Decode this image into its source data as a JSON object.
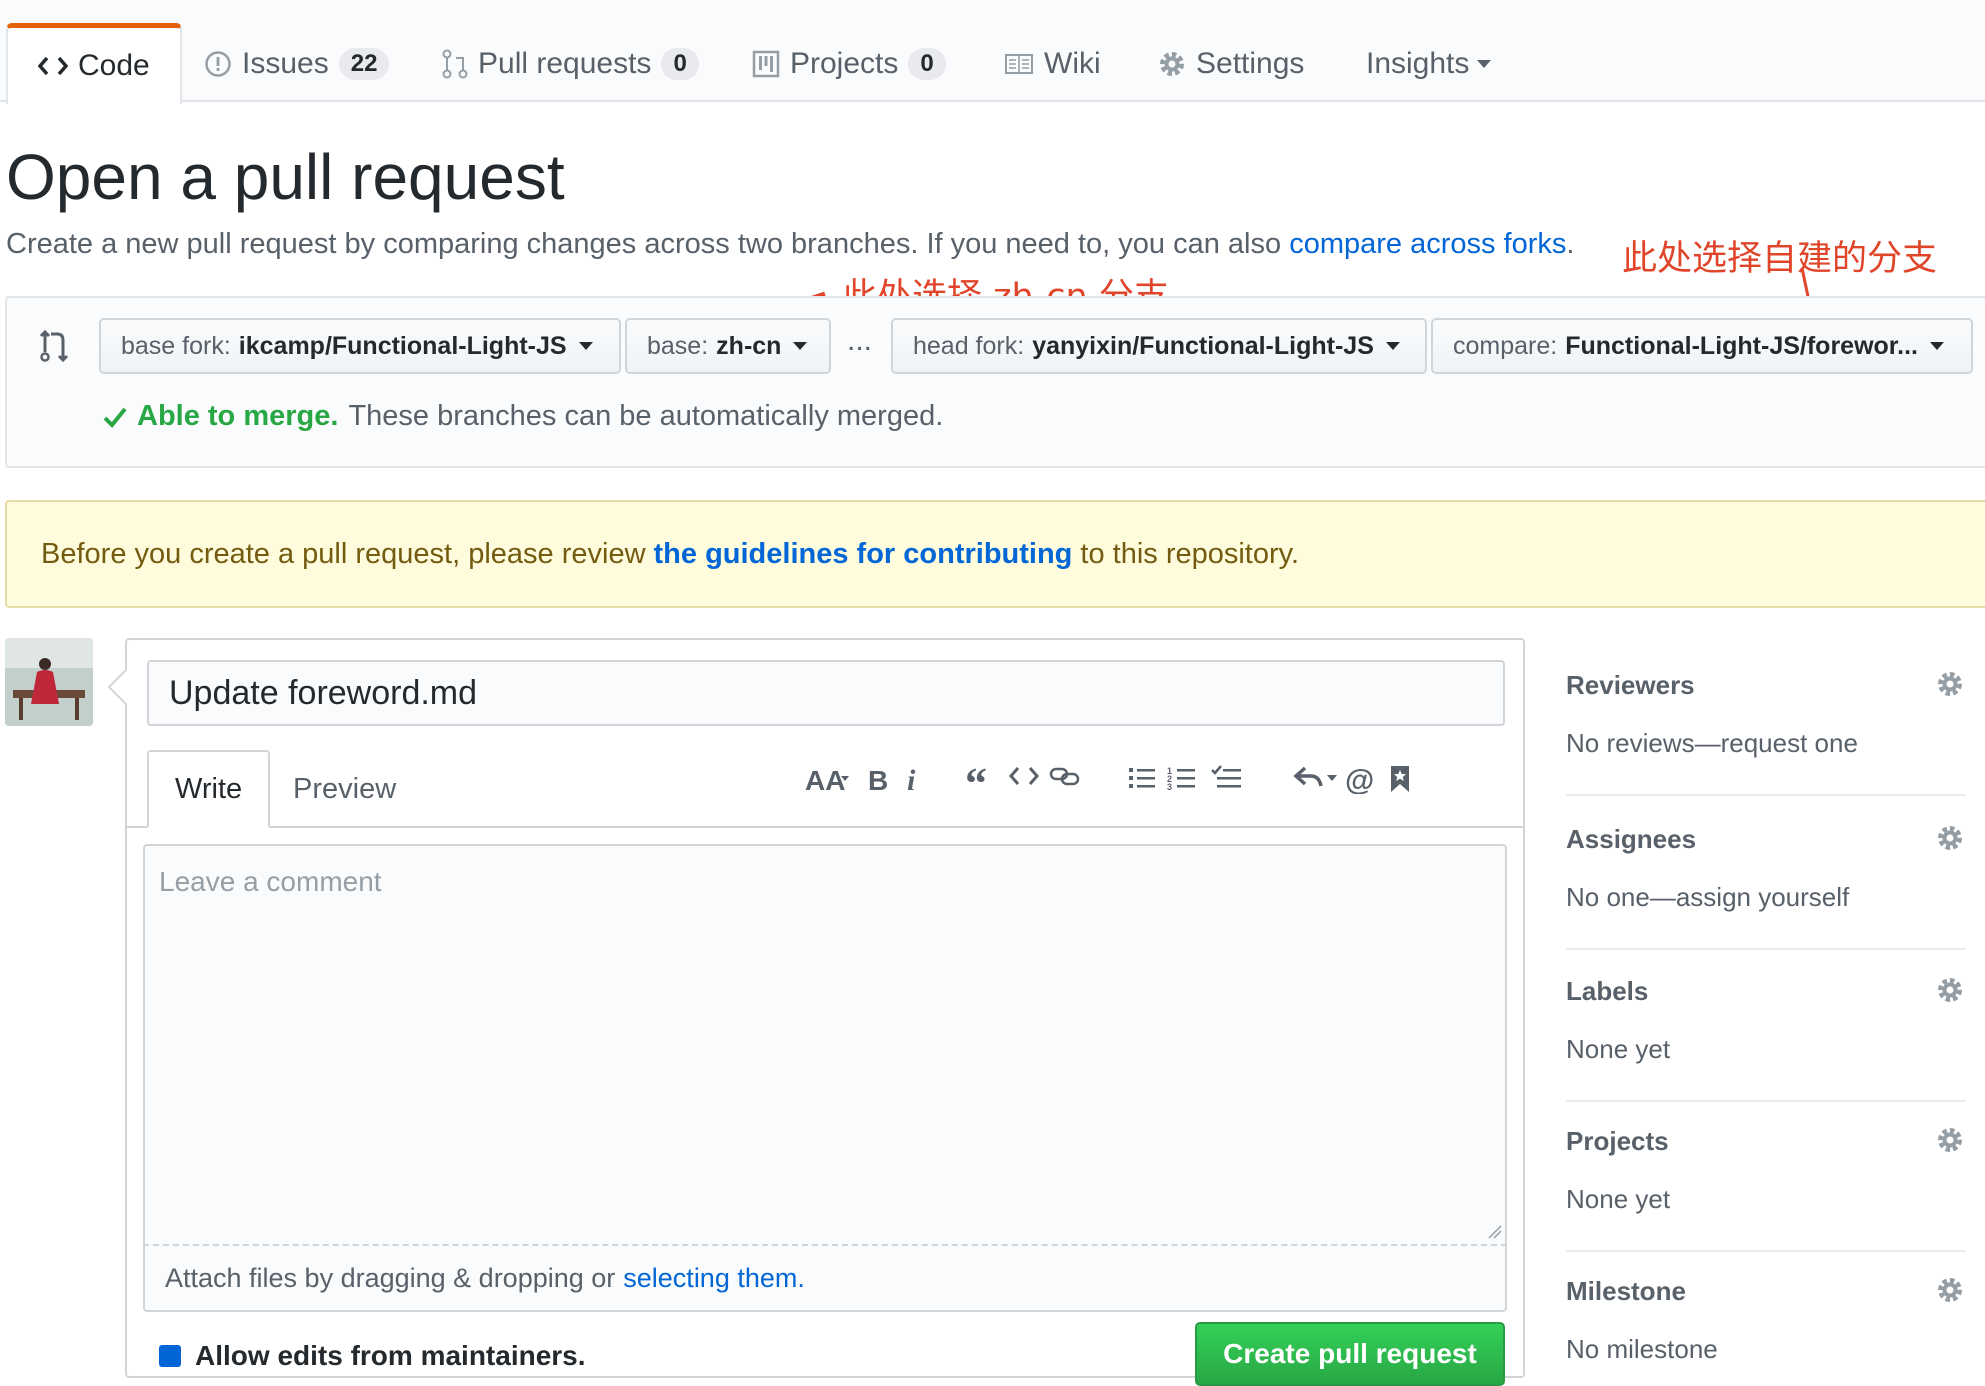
{
  "nav": {
    "tabs": [
      {
        "label": "Code"
      },
      {
        "label": "Issues",
        "count": "22"
      },
      {
        "label": "Pull requests",
        "count": "0"
      },
      {
        "label": "Projects",
        "count": "0"
      },
      {
        "label": "Wiki"
      },
      {
        "label": "Settings"
      },
      {
        "label": "Insights"
      }
    ]
  },
  "header": {
    "title": "Open a pull request",
    "subtitle": "Create a new pull request by comparing changes across two branches. If you need to, you can also",
    "subtitle_link": "compare across forks",
    "subtitle_end": "."
  },
  "annotations": {
    "base_note": "此处选择 zh-cn 分支",
    "compare_note": "此处选择自建的分支",
    "color": "#e0452a"
  },
  "compare": {
    "base_fork_label": "base fork:",
    "base_fork_value": "ikcamp/Functional-Light-JS",
    "base_label": "base:",
    "base_value": "zh-cn",
    "separator": "...",
    "head_fork_label": "head fork:",
    "head_fork_value": "yanyixin/Functional-Light-JS",
    "compare_label": "compare:",
    "compare_value": "Functional-Light-JS/forewor...",
    "merge_status": "Able to merge.",
    "merge_message": "These branches can be automatically merged."
  },
  "flash": {
    "before": "Before you create a pull request, please review",
    "link": "the guidelines for contributing",
    "after": "to this repository."
  },
  "composer": {
    "title_value": "Update foreword.md",
    "tab_write": "Write",
    "tab_preview": "Preview",
    "comment_placeholder": "Leave a comment",
    "attach_text": "Attach files by dragging & dropping or",
    "attach_link": "selecting them.",
    "allow_edits": "Allow edits from maintainers.",
    "create_button": "Create pull request"
  },
  "sidebar": [
    {
      "heading": "Reviewers",
      "value": "No reviews—request one"
    },
    {
      "heading": "Assignees",
      "value": "No one—assign yourself"
    },
    {
      "heading": "Labels",
      "value": "None yet"
    },
    {
      "heading": "Projects",
      "value": "None yet"
    },
    {
      "heading": "Milestone",
      "value": "No milestone"
    }
  ],
  "colors": {
    "accent_link": "#0366d6",
    "success": "#28a745",
    "tab_highlight": "#e36209",
    "flash_bg": "#fffbdd"
  }
}
